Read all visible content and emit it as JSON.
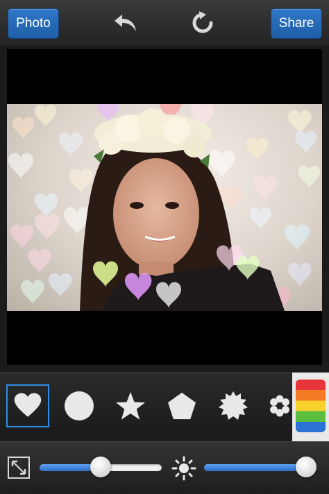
{
  "toolbar": {
    "photo_label": "Photo",
    "share_label": "Share",
    "undo_icon": "undo-icon",
    "reset_icon": "refresh-icon"
  },
  "shapes": [
    {
      "name": "heart",
      "selected": true
    },
    {
      "name": "circle",
      "selected": false
    },
    {
      "name": "star",
      "selected": false
    },
    {
      "name": "pentagon",
      "selected": false
    },
    {
      "name": "starburst",
      "selected": false
    },
    {
      "name": "flower",
      "selected": false
    }
  ],
  "color_swatch": {
    "icon": "rainbow-color-icon",
    "colors": [
      "#e8343b",
      "#f57a24",
      "#f6d22b",
      "#5bbe3e",
      "#2d73d5"
    ]
  },
  "sliders": {
    "size_icon": "resize-icon",
    "size_value": 0.5,
    "brightness_icon": "brightness-icon",
    "brightness_value": 1.0
  },
  "colors": {
    "accent": "#2f78c8",
    "selection": "#2f8ee8"
  }
}
